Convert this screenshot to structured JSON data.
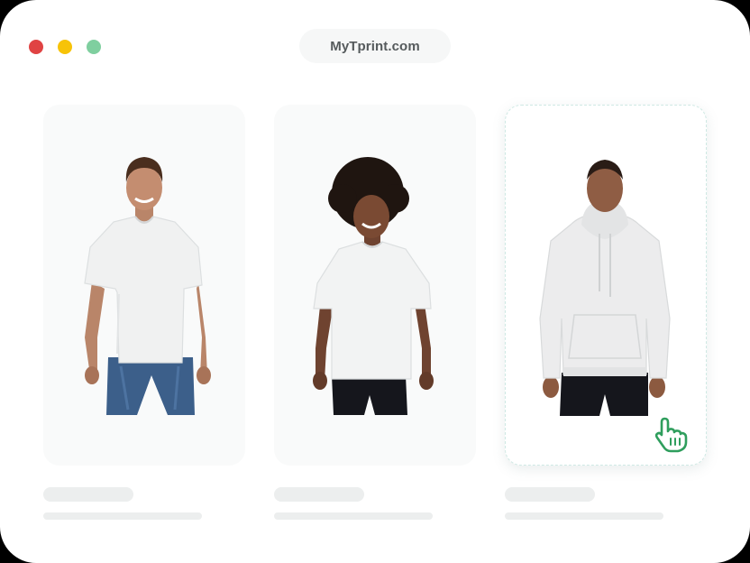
{
  "window": {
    "controls": [
      "close",
      "minimize",
      "maximize"
    ]
  },
  "browser": {
    "url": "MyTprint.com"
  },
  "products": [
    {
      "icon": "adult-tshirt-model",
      "selected": false
    },
    {
      "icon": "kids-tshirt-model",
      "selected": false
    },
    {
      "icon": "hoodie-model",
      "selected": true
    }
  ],
  "pointer": {
    "icon": "hand-pointer-icon",
    "color": "#2f9e5d"
  },
  "colors": {
    "background": "#ffffff",
    "card": "#f9fafa",
    "skeleton": "#eceeee",
    "accent": "#2f9e5d",
    "close": "#e04343",
    "minimize": "#f7c308",
    "maximize": "#7fcf9f"
  }
}
